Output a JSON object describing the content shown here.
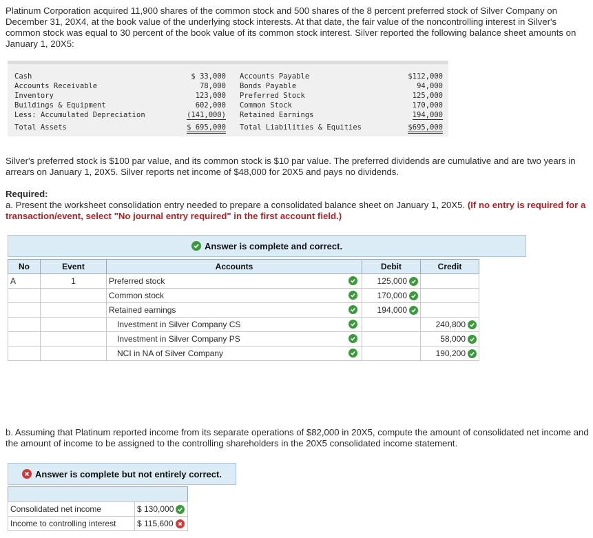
{
  "intro": "Platinum Corporation acquired 11,900 shares of the common stock and 500 shares of the 8 percent preferred stock of Silver Company on December 31, 20X4, at the book value of the underlying stock interests. At that date, the fair value of the noncontrolling interest in Silver's common stock was equal to 30 percent of the book value of its common stock interest. Silver reported the following balance sheet amounts on January 1, 20X5:",
  "balance_sheet": {
    "assets": [
      {
        "label": "Cash",
        "amount": "$ 33,000"
      },
      {
        "label": "Accounts Receivable",
        "amount": "78,000"
      },
      {
        "label": "Inventory",
        "amount": "123,000"
      },
      {
        "label": "Buildings & Equipment",
        "amount": "602,000"
      },
      {
        "label": "Less: Accumulated Depreciation",
        "amount": "(141,000)"
      }
    ],
    "total_assets": {
      "label": "Total Assets",
      "amount": "$ 695,000"
    },
    "liabilities": [
      {
        "label": "Accounts Payable",
        "amount": "$112,000"
      },
      {
        "label": "Bonds Payable",
        "amount": "94,000"
      },
      {
        "label": "Preferred Stock",
        "amount": "125,000"
      },
      {
        "label": "Common Stock",
        "amount": "170,000"
      },
      {
        "label": "Retained Earnings",
        "amount": "194,000"
      }
    ],
    "total_liabilities": {
      "label": "Total Liabilities & Equities",
      "amount": "$695,000"
    }
  },
  "para2": "Silver's preferred stock is $100 par value, and its common stock is $10 par value. The preferred dividends are cumulative and are two years in arrears on January 1, 20X5. Silver reports net income of $48,000 for 20X5 and pays no dividends.",
  "required": {
    "label": "Required:",
    "part_a": "a. Present the worksheet consolidation entry needed to prepare a consolidated balance sheet on January 1, 20X5.",
    "part_a_note": "(If no entry is required for a transaction/event, select \"No journal entry required\" in the first account field.)"
  },
  "answer_a_banner": "Answer is complete and correct.",
  "journal": {
    "headers": {
      "no": "No",
      "event": "Event",
      "accounts": "Accounts",
      "debit": "Debit",
      "credit": "Credit"
    },
    "rows": [
      {
        "no": "A",
        "event": "1",
        "account": "Preferred stock",
        "indent": false,
        "debit": "125,000",
        "credit": ""
      },
      {
        "no": "",
        "event": "",
        "account": "Common stock",
        "indent": false,
        "debit": "170,000",
        "credit": ""
      },
      {
        "no": "",
        "event": "",
        "account": "Retained earnings",
        "indent": false,
        "debit": "194,000",
        "credit": ""
      },
      {
        "no": "",
        "event": "",
        "account": "Investment in Silver Company CS",
        "indent": true,
        "debit": "",
        "credit": "240,800"
      },
      {
        "no": "",
        "event": "",
        "account": "Investment in Silver Company PS",
        "indent": true,
        "debit": "",
        "credit": "58,000"
      },
      {
        "no": "",
        "event": "",
        "account": "NCI in NA of Silver Company",
        "indent": true,
        "debit": "",
        "credit": "190,200"
      }
    ]
  },
  "part_b": "b. Assuming that Platinum reported income from its separate operations of $82,000 in 20X5, compute the amount of consolidated net income and the amount of income to be assigned to the controlling shareholders in the 20X5 consolidated income statement.",
  "answer_b_banner": "Answer is complete but not entirely correct.",
  "income": {
    "rows": [
      {
        "label": "Consolidated net income",
        "value": "$ 130,000",
        "status": "correct"
      },
      {
        "label": "Income to controlling interest",
        "value": "$ 115,600",
        "status": "incorrect"
      }
    ]
  },
  "colors": {
    "banner_bg": "#dcecf7",
    "correct": "#3b9a3b",
    "incorrect": "#d23a3a",
    "note_red": "#b0232a"
  }
}
